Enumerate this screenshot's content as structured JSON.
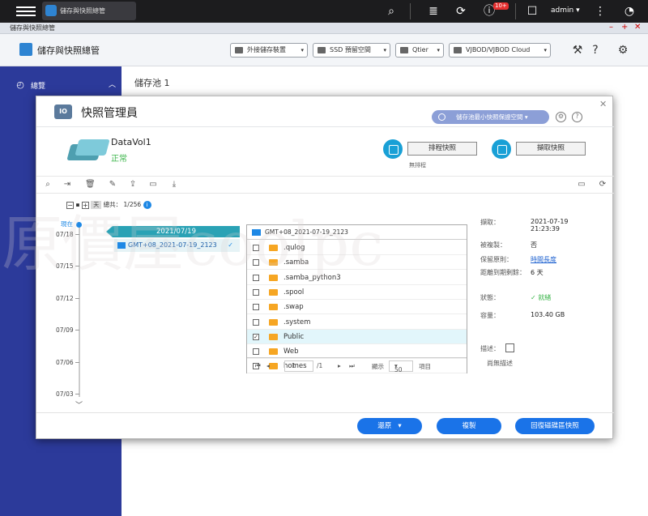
{
  "topbar": {
    "tab_title": "儲存與快照總管",
    "badge": "10+",
    "user": "admin"
  },
  "window": {
    "title": "儲存與快照總管",
    "controls": [
      "–",
      "+",
      "✕"
    ]
  },
  "appbar": {
    "title": "儲存與快照總管",
    "buttons": [
      "外接儲存裝置",
      "SSD 預留空間",
      "Qtier",
      "VJBOD/VJBOD Cloud"
    ]
  },
  "sidebar": {
    "overview": "總覽"
  },
  "main": {
    "page_title": "儲存池 1"
  },
  "dialog": {
    "title": "快照管理員",
    "pill": "儲存池最小快照保證空間",
    "volume": {
      "name": "DataVol1",
      "status": "正常"
    },
    "schedule_button": "排程快照",
    "schedule_note": "無排程",
    "take_button": "擷取快照",
    "tree": {
      "day": "天",
      "total": "總共： 1/256",
      "now": "現在"
    },
    "timeline_ticks": [
      "07/18",
      "07/15",
      "07/12",
      "07/09",
      "07/06",
      "07/03"
    ],
    "selected_date": "2021/07/19",
    "snapshot": "GMT+08_2021-07-19_2123",
    "files_header": "GMT+08_2021-07-19_2123",
    "files": [
      {
        "name": ".qulog",
        "checked": false
      },
      {
        "name": ".samba",
        "checked": false
      },
      {
        "name": ".samba_python3",
        "checked": false
      },
      {
        "name": ".spool",
        "checked": false
      },
      {
        "name": ".swap",
        "checked": false
      },
      {
        "name": ".system",
        "checked": false
      },
      {
        "name": "Public",
        "checked": true
      },
      {
        "name": "Web",
        "checked": false
      },
      {
        "name": "homes",
        "checked": false
      }
    ],
    "pagination": {
      "page": "1",
      "of": "/1",
      "show_label": "顯示",
      "per_page": "50",
      "items_label": "項目"
    },
    "properties": [
      {
        "label": "擷取：",
        "value": "2021-07-19\n21:23:39"
      },
      {
        "label": "被複製：",
        "value": "否"
      },
      {
        "label": "保留原則：",
        "value": "時間長度"
      },
      {
        "label": "距離到期剩餘：",
        "value": "6 天"
      },
      {
        "label": "狀態：",
        "value": "就緒"
      },
      {
        "label": "容量：",
        "value": "103.40 GB"
      }
    ],
    "description_label": "描述：",
    "description_value": "尚無描述",
    "buttons": {
      "restore": "還原",
      "clone": "複製",
      "revert": "回復磁碟區快照"
    }
  },
  "watermark": "原價屋coolpc",
  "colors": {
    "accent": "#1a73e8",
    "sidebar": "#2c3a9a",
    "ok": "#3bb54a",
    "folder": "#f6a623",
    "date_tab": "#2aa2b5"
  }
}
